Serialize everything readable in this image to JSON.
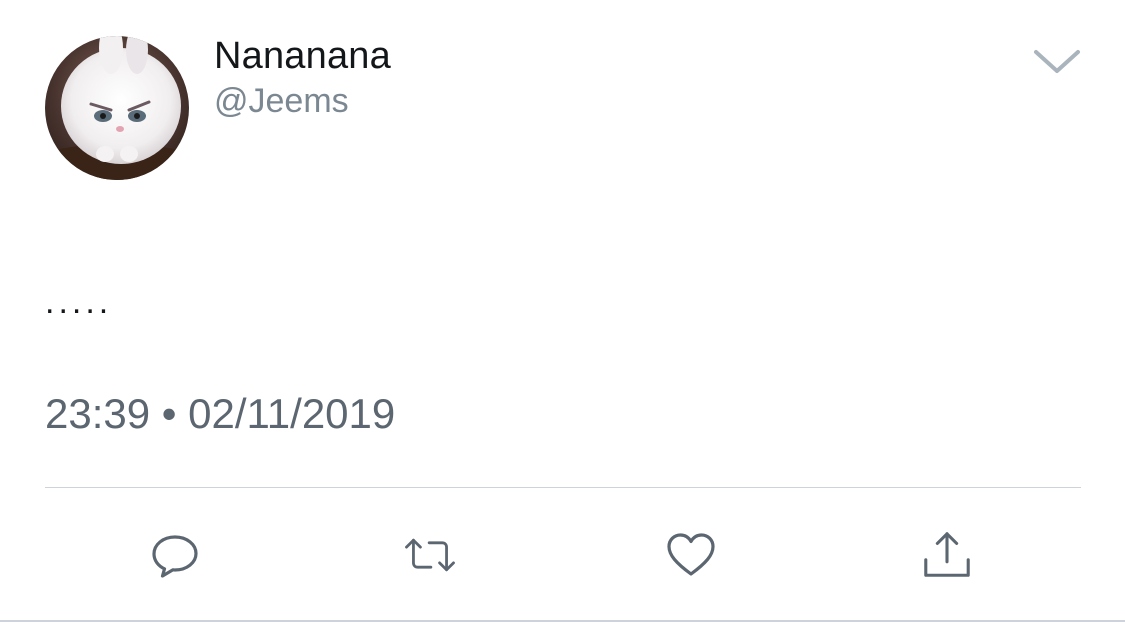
{
  "tweet": {
    "display_name": "Nananana",
    "handle": "@Jeems",
    "text": ".....",
    "time": "23:39",
    "separator": "•",
    "date": "02/11/2019"
  },
  "icons": {
    "caret": "chevron-down-icon",
    "reply": "reply-icon",
    "retweet": "retweet-icon",
    "like": "heart-icon",
    "share": "share-icon"
  },
  "colors": {
    "text_primary": "#14171a",
    "text_secondary": "#7b8791",
    "icon": "#5c6670",
    "divider": "#cdd3d8"
  }
}
